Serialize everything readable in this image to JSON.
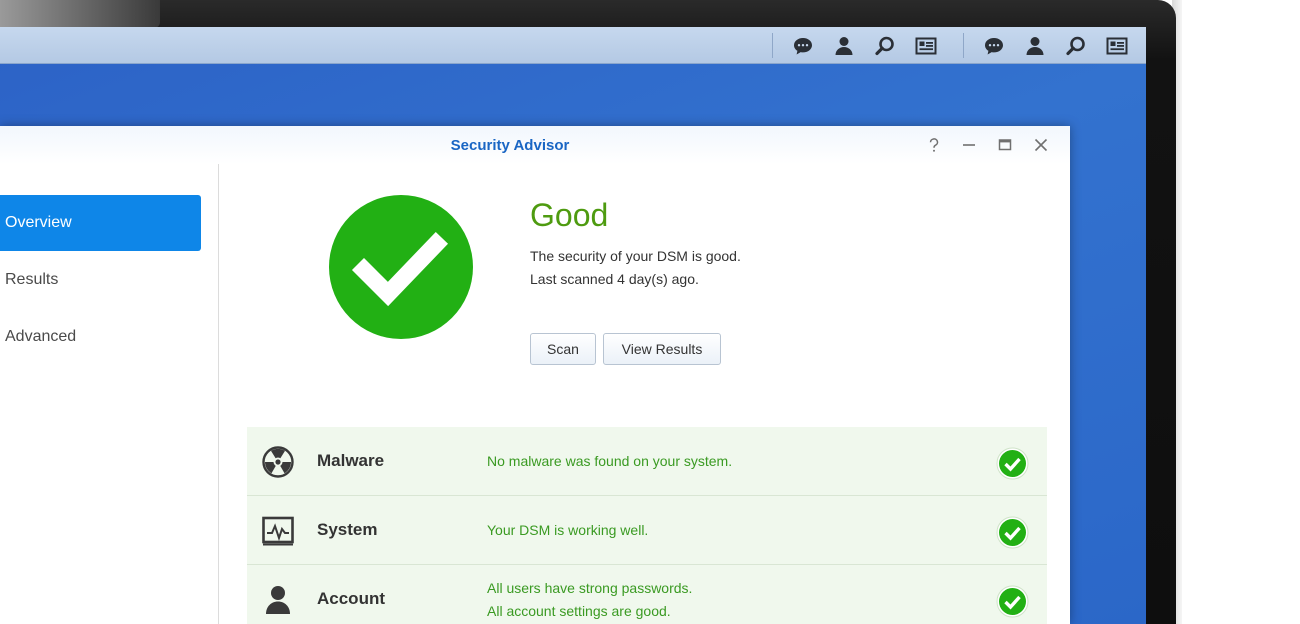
{
  "window": {
    "title": "Security Advisor"
  },
  "sidebar": {
    "items": [
      {
        "label": "Overview",
        "active": true
      },
      {
        "label": "Results",
        "active": false
      },
      {
        "label": "Advanced",
        "active": false
      }
    ]
  },
  "status": {
    "title": "Good",
    "line1": "The security of your DSM is good.",
    "line2": "Last scanned 4 day(s) ago.",
    "scan_label": "Scan",
    "view_results_label": "View Results"
  },
  "categories": [
    {
      "name": "Malware",
      "msg1": "No malware was found on your system.",
      "msg2": ""
    },
    {
      "name": "System",
      "msg1": "Your DSM is working well.",
      "msg2": ""
    },
    {
      "name": "Account",
      "msg1": "All users have strong passwords.",
      "msg2": "All account settings are good."
    }
  ],
  "taskbar": {
    "icons": [
      "chat-icon",
      "user-icon",
      "search-icon",
      "widget-icon",
      "chat-icon",
      "user-icon",
      "search-icon",
      "widget-icon"
    ]
  },
  "colors": {
    "accent": "#0e86e8",
    "good": "#22b014",
    "title_blue": "#1a66c4",
    "status_green": "#4e9b10"
  }
}
